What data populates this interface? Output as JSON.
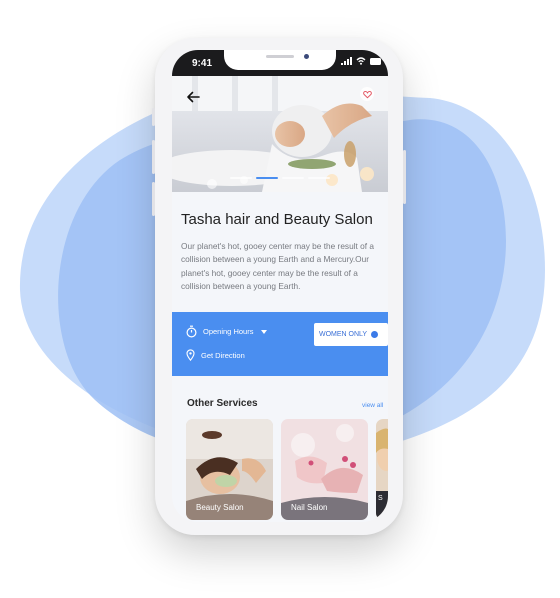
{
  "status": {
    "time": "9:41"
  },
  "hero": {
    "slide_count": 4,
    "active_slide": 2
  },
  "salon": {
    "name": "Tasha hair and Beauty Salon",
    "description": "Our planet's hot, gooey center may be the result of a collision between a young Earth and a Mercury.Our planet's hot, gooey center may be the result of a collision between a young Earth."
  },
  "info_bar": {
    "opening_hours": "Opening Hours",
    "directions": "Get Direction",
    "badge": "WOMEN ONLY",
    "women_only_enabled": true
  },
  "services": {
    "title": "Other Services",
    "view_all": "view all",
    "items": [
      {
        "label": "Beauty Salon"
      },
      {
        "label": "Nail Salon"
      },
      {
        "label": "S"
      }
    ]
  },
  "colors": {
    "accent": "#4a8ef0",
    "blob": "#9ec0f5",
    "blob_light": "#c6dbfa"
  }
}
